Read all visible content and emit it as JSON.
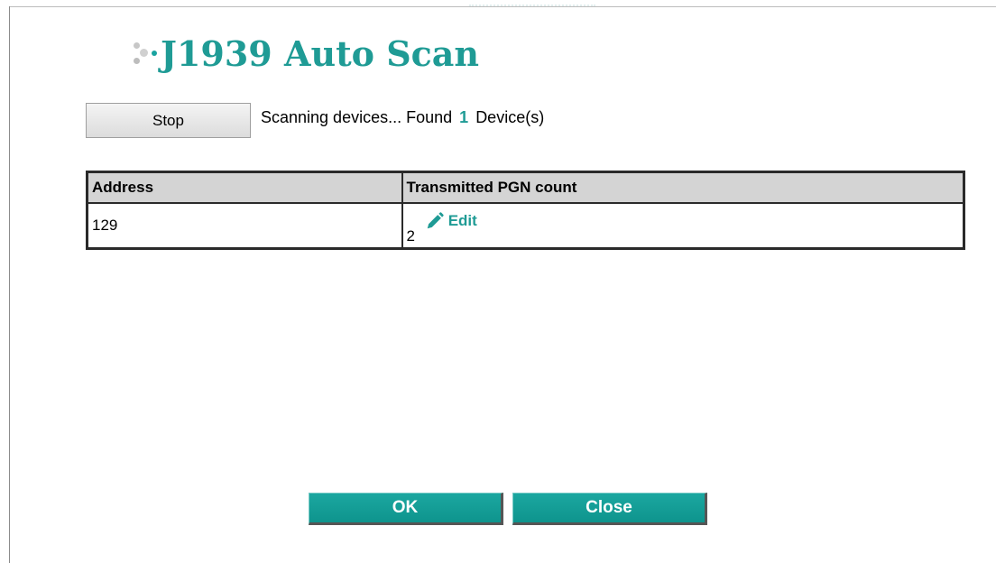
{
  "dialog": {
    "title": "J1939 Auto Scan"
  },
  "scan": {
    "stop_label": "Stop",
    "status_prefix": "Scanning devices... Found",
    "found_count": "1",
    "status_suffix": "Device(s)"
  },
  "table": {
    "headers": [
      "Address",
      "Transmitted PGN count"
    ],
    "rows": [
      {
        "address": "129",
        "pgn_count": "2",
        "edit_label": "Edit"
      }
    ]
  },
  "footer": {
    "ok_label": "OK",
    "close_label": "Close"
  },
  "colors": {
    "accent": "#1f9b95",
    "button_teal": "#13a09a",
    "header_bg": "#d4d4d4"
  },
  "icons": {
    "title_bullet": "dots-bullet-icon",
    "edit": "pencil-icon"
  }
}
